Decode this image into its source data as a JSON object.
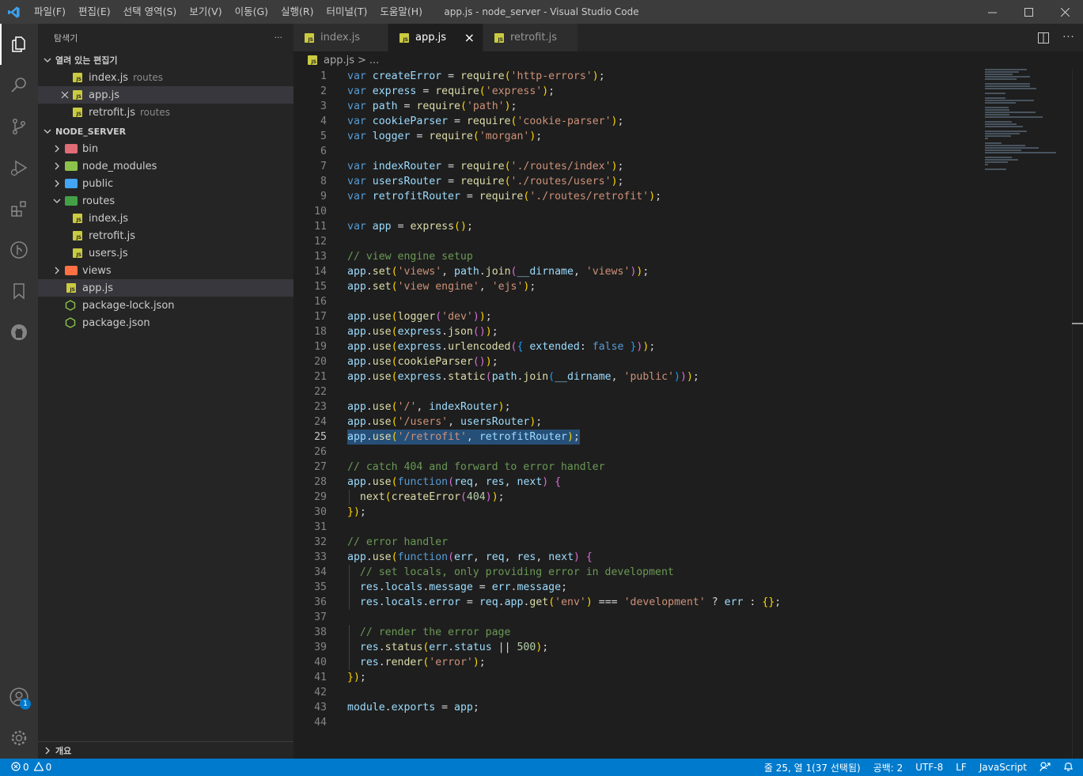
{
  "window": {
    "title": "app.js - node_server - Visual Studio Code",
    "menu": [
      "파일(F)",
      "편집(E)",
      "선택 영역(S)",
      "보기(V)",
      "이동(G)",
      "실행(R)",
      "터미널(T)",
      "도움말(H)"
    ]
  },
  "activity_badge": "1",
  "sidebar": {
    "title": "탐색기",
    "more": "···",
    "open_editors_title": "열려 있는 편집기",
    "open_editors": [
      {
        "name": "index.js",
        "desc": "routes"
      },
      {
        "name": "app.js",
        "desc": ""
      },
      {
        "name": "retrofit.js",
        "desc": "routes"
      }
    ],
    "project_title": "NODE_SERVER",
    "tree": {
      "bin": "bin",
      "node_modules": "node_modules",
      "public": "public",
      "routes": "routes",
      "routes_index": "index.js",
      "routes_retrofit": "retrofit.js",
      "routes_users": "users.js",
      "views": "views",
      "app": "app.js",
      "package_lock": "package-lock.json",
      "package": "package.json"
    },
    "outline_title": "개요"
  },
  "tabs": [
    {
      "label": "index.js",
      "active": false
    },
    {
      "label": "app.js",
      "active": true
    },
    {
      "label": "retrofit.js",
      "active": false
    }
  ],
  "tab_close": "×",
  "breadcrumb": {
    "file": "app.js",
    "sep": ">",
    "more": "..."
  },
  "code": {
    "lines": [
      "var createError = require('http-errors');",
      "var express = require('express');",
      "var path = require('path');",
      "var cookieParser = require('cookie-parser');",
      "var logger = require('morgan');",
      "",
      "var indexRouter = require('./routes/index');",
      "var usersRouter = require('./routes/users');",
      "var retrofitRouter = require('./routes/retrofit');",
      "",
      "var app = express();",
      "",
      "// view engine setup",
      "app.set('views', path.join(__dirname, 'views'));",
      "app.set('view engine', 'ejs');",
      "",
      "app.use(logger('dev'));",
      "app.use(express.json());",
      "app.use(express.urlencoded({ extended: false }));",
      "app.use(cookieParser());",
      "app.use(express.static(path.join(__dirname, 'public')));",
      "",
      "app.use('/', indexRouter);",
      "app.use('/users', usersRouter);",
      "app.use('/retrofit', retrofitRouter);",
      "",
      "// catch 404 and forward to error handler",
      "app.use(function(req, res, next) {",
      "  next(createError(404));",
      "});",
      "",
      "// error handler",
      "app.use(function(err, req, res, next) {",
      "  // set locals, only providing error in development",
      "  res.locals.message = err.message;",
      "  res.locals.error = req.app.get('env') === 'development' ? err : {};",
      "",
      "  // render the error page",
      "  res.status(err.status || 500);",
      "  res.render('error');",
      "});",
      "",
      "module.exports = app;",
      ""
    ],
    "current_line": 25,
    "selected_line": 25
  },
  "statusbar": {
    "errors": "0",
    "warnings": "0",
    "position": "줄 25, 열 1(37 선택됨)",
    "spaces": "공백: 2",
    "encoding": "UTF-8",
    "eol": "LF",
    "language": "JavaScript"
  },
  "colors": {
    "accent": "#007acc",
    "keyword": "#569cd6",
    "string": "#ce9178",
    "comment": "#6a9955",
    "function": "#dcdcaa",
    "variable": "#9cdcfe",
    "selection": "#264f78"
  }
}
